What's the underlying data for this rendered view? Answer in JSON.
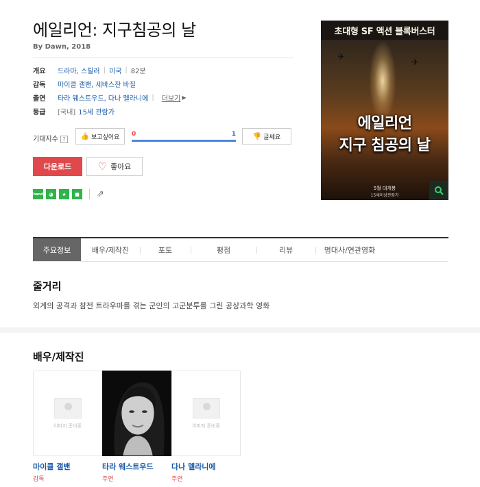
{
  "movie": {
    "title": "에일리언: 지구침공의 날",
    "byline": "By Dawn, 2018"
  },
  "info": {
    "overview_label": "개요",
    "genres": "드라마, 스릴러",
    "country": "미국",
    "runtime": "82분",
    "director_label": "감독",
    "directors": "마이클 갤밴, 세바스찬 바질",
    "cast_label": "출연",
    "cast": "타라 웨스트우드, 다나 멜라니에",
    "more": "더보기",
    "rating_label": "등급",
    "rating_region": "[국내]",
    "rating": "15세 관람가"
  },
  "expectation": {
    "label": "기대지수",
    "help": "?",
    "want_button": "보고싶어요",
    "bad_button": "글쎄요",
    "want_count": "0",
    "bad_count": "1",
    "want_ratio": 0,
    "bad_ratio": 1
  },
  "actions": {
    "download": "다운로드",
    "like": "좋아요"
  },
  "share_icons": [
    "band-icon",
    "kakaostory-icon",
    "star-share-icon",
    "square-share-icon",
    "share-icon"
  ],
  "share_glyphs": {
    "band": "band",
    "kakaostory": "◕",
    "star": "★",
    "square": "■",
    "share": "⇗"
  },
  "poster": {
    "tagline": "초대형 SF 액션 블록버스터",
    "title_line1": "에일리언",
    "title_line2": "지구 침공의 날",
    "release": "5월 대개봉",
    "rating_note": "15세이상관람가"
  },
  "tabs": [
    "주요정보",
    "배우/제작진",
    "포토",
    "평점",
    "리뷰",
    "명대사/연관영화"
  ],
  "synopsis": {
    "heading": "줄거리",
    "text": "외계의 공격과 참전 트라우마를 겪는 군인의 고군분투를 그린 공상과학 영화"
  },
  "crew": {
    "heading": "배우/제작진",
    "no_image_text": "이미지 준비중",
    "people": [
      {
        "name": "마이클 갤밴",
        "role": "감독",
        "has_photo": false
      },
      {
        "name": "타라 웨스트우드",
        "role": "주연",
        "has_photo": true
      },
      {
        "name": "다나 멜라니에",
        "role": "주연",
        "has_photo": false
      }
    ]
  },
  "colors": {
    "accent_red": "#e0484c",
    "link_blue": "#1a5aa8",
    "share_green": "#2fb34a"
  }
}
